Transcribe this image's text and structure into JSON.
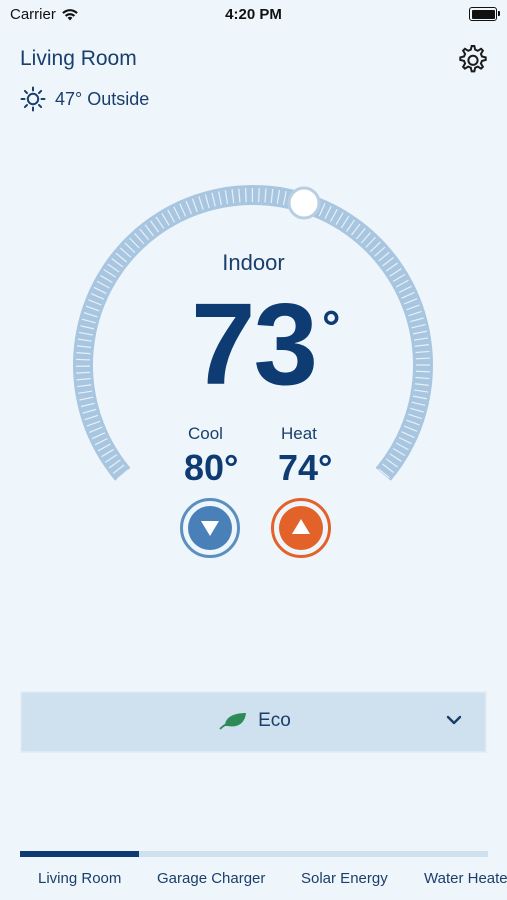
{
  "status_bar": {
    "carrier": "Carrier",
    "time": "4:20 PM"
  },
  "header": {
    "title": "Living Room",
    "outside": "47° Outside"
  },
  "thermostat": {
    "indoor_label": "Indoor",
    "indoor_temp": "73",
    "degree_symbol": "°",
    "cool_label": "Cool",
    "cool_value": "80°",
    "heat_label": "Heat",
    "heat_value": "74°"
  },
  "mode": {
    "selected": "Eco"
  },
  "tabs": [
    {
      "label": "Living Room",
      "active": true
    },
    {
      "label": "Garage Charger",
      "active": false
    },
    {
      "label": "Solar Energy",
      "active": false
    },
    {
      "label": "Water Heater",
      "active": false
    }
  ],
  "colors": {
    "background": "#eef6fc",
    "primary": "#0d3b72",
    "cool": "#4a80b8",
    "heat": "#e2622a",
    "eco_leaf": "#2e8b57"
  }
}
